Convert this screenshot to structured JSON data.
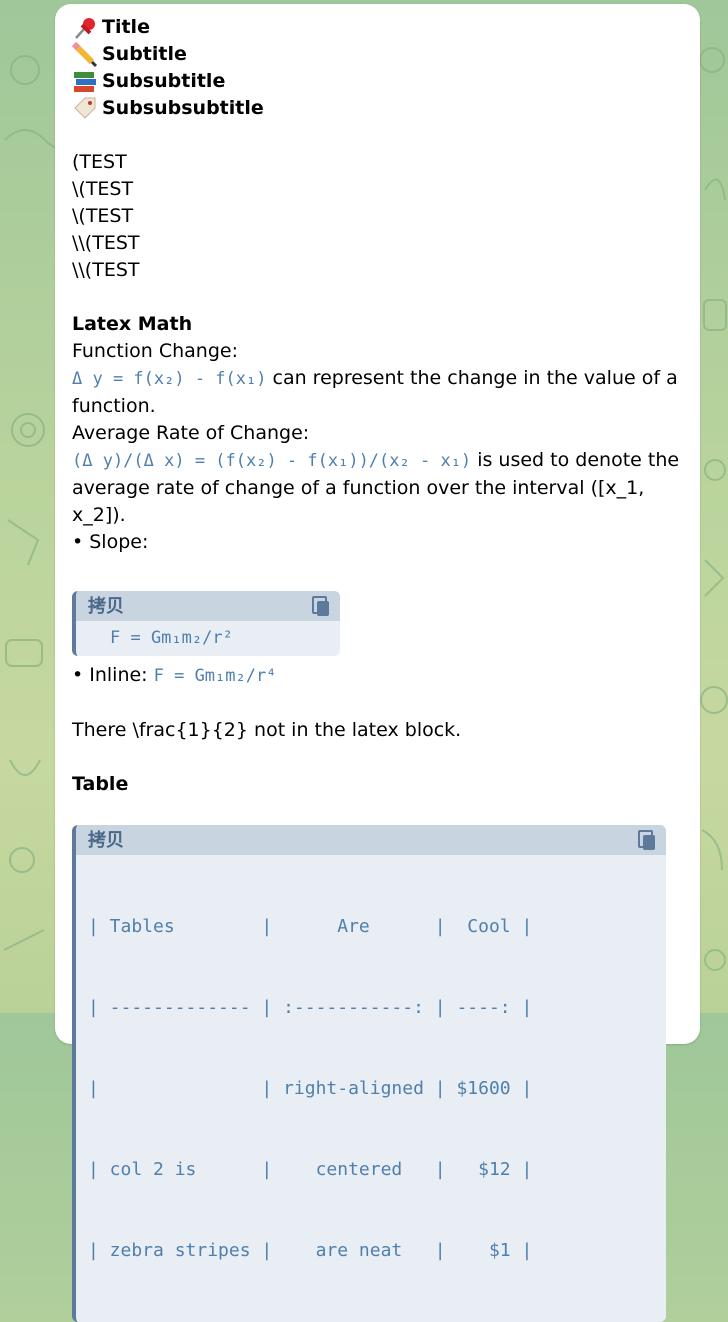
{
  "headings": [
    {
      "icon": "pushpin-icon",
      "text": "Title"
    },
    {
      "icon": "pencil-icon",
      "text": "Subtitle"
    },
    {
      "icon": "books-icon",
      "text": "Subsubtitle"
    },
    {
      "icon": "label-tag-icon",
      "text": "Subsubsubtitle"
    }
  ],
  "paren_lines": [
    "(TEST",
    "\\(TEST",
    "\\(TEST",
    "\\\\(TEST",
    "\\\\(TEST"
  ],
  "latex": {
    "heading": "Latex Math",
    "function_change_label": "Function Change:",
    "function_change_formula": "Δ y = f(x₂) - f(x₁)",
    "function_change_text": " can represent the change in the value of a function.",
    "avg_rate_label": "Average Rate of Change:",
    "avg_rate_formula": "(Δ y)/(Δ x) = (f(x₂) - f(x₁))/(x₂ - x₁)",
    "avg_rate_text": " is used to denote the average rate of change of a function over the interval ([x_1, x_2]).",
    "slope_label": "• Slope:",
    "code1_header": "拷贝",
    "code1_body": "F = Gm₁m₂/r²",
    "inline_label": "• Inline: ",
    "inline_formula": "F = Gm₁m₂/r⁴",
    "frac_text": "There \\frac{1}{2} not in the latex block."
  },
  "table_section": {
    "heading": "Table",
    "code_header": "拷贝",
    "rows": [
      "| Tables        |      Are      |  Cool |",
      "| ------------- | :-----------: | ----: |",
      "|               | right-aligned | $1600 |",
      "| col 2 is      |    centered   |   $12 |",
      "| zebra stripes |    are neat   |    $1 |"
    ]
  },
  "colors": {
    "code_text": "#4f7fae",
    "code_bg": "#e8eef4",
    "code_header_bg": "#c8d4e0",
    "code_bar": "#5d7a9b"
  }
}
